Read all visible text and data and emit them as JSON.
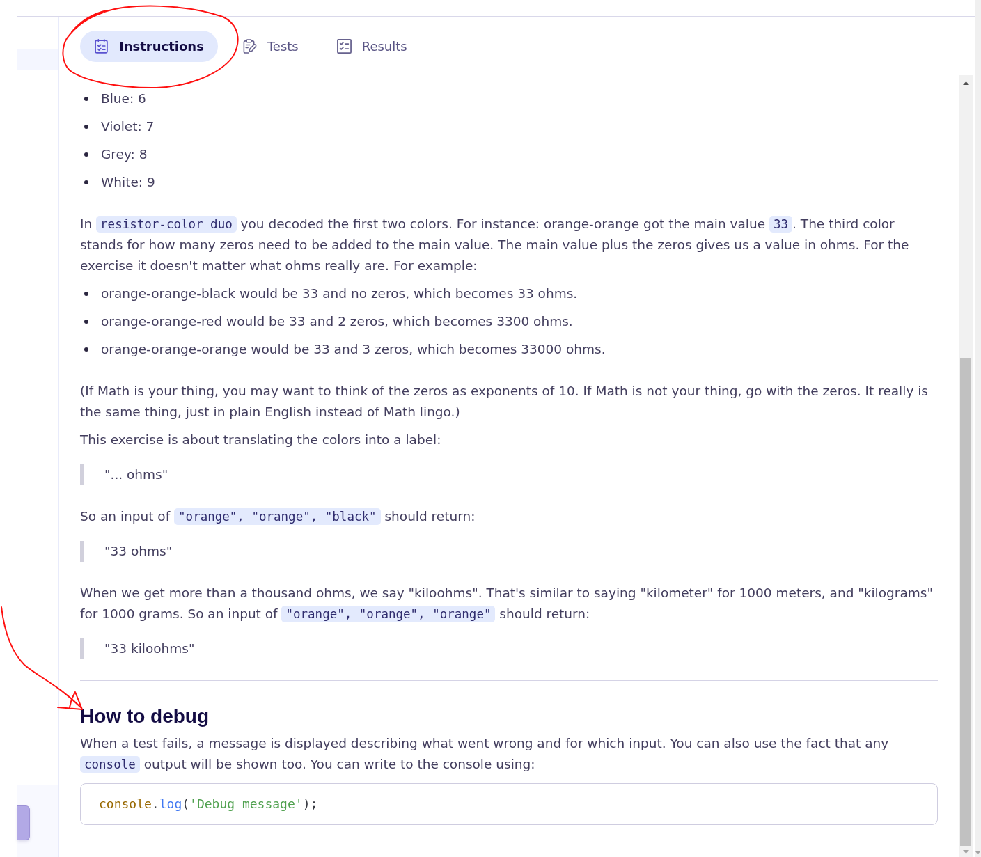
{
  "tabs": [
    {
      "label": "Instructions",
      "selected": true
    },
    {
      "label": "Tests",
      "selected": false
    },
    {
      "label": "Results",
      "selected": false
    }
  ],
  "content": [
    {
      "kind": "list",
      "items": [
        "Blue: 6",
        "Violet: 7",
        "Grey: 8",
        "White: 9"
      ]
    },
    {
      "kind": "paragraph",
      "parts": [
        {
          "kind": "text",
          "text": "In "
        },
        {
          "kind": "code",
          "text": "resistor-color duo"
        },
        {
          "kind": "text",
          "text": " you decoded the first two colors. For instance: orange-orange got the main value "
        },
        {
          "kind": "code",
          "text": "33"
        },
        {
          "kind": "text",
          "text": ". The third color stands for how many zeros need to be added to the main value. The main value plus the zeros gives us a value in ohms. For the exercise it doesn't matter what ohms really are. For example:"
        }
      ]
    },
    {
      "kind": "list",
      "items": [
        "orange-orange-black would be 33 and no zeros, which becomes 33 ohms.",
        "orange-orange-red would be 33 and 2 zeros, which becomes 3300 ohms.",
        "orange-orange-orange would be 33 and 3 zeros, which becomes 33000 ohms."
      ]
    },
    {
      "kind": "paragraph",
      "parts": [
        {
          "kind": "text",
          "text": "(If Math is your thing, you may want to think of the zeros as exponents of 10. If Math is not your thing, go with the zeros. It really is the same thing, just in plain English instead of Math lingo.)"
        }
      ]
    },
    {
      "kind": "paragraph",
      "parts": [
        {
          "kind": "text",
          "text": "This exercise is about translating the colors into a label:"
        }
      ]
    },
    {
      "kind": "quote",
      "text": "\"... ohms\""
    },
    {
      "kind": "paragraph",
      "parts": [
        {
          "kind": "text",
          "text": "So an input of "
        },
        {
          "kind": "code",
          "text": "\"orange\", \"orange\", \"black\""
        },
        {
          "kind": "text",
          "text": " should return:"
        }
      ]
    },
    {
      "kind": "quote",
      "text": "\"33 ohms\""
    },
    {
      "kind": "paragraph",
      "parts": [
        {
          "kind": "text",
          "text": "When we get more than a thousand ohms, we say \"kiloohms\". That's similar to saying \"kilometer\" for 1000 meters, and \"kilograms\" for 1000 grams. So an input of "
        },
        {
          "kind": "code",
          "text": "\"orange\", \"orange\", \"orange\""
        },
        {
          "kind": "text",
          "text": " should return:"
        }
      ]
    },
    {
      "kind": "quote",
      "text": "\"33 kiloohms\""
    },
    {
      "kind": "divider"
    },
    {
      "kind": "heading",
      "text": "How to debug"
    },
    {
      "kind": "paragraph",
      "parts": [
        {
          "kind": "text",
          "text": "When a test fails, a message is displayed describing what went wrong and for which input. You can also use the fact that any "
        },
        {
          "kind": "code",
          "text": "console"
        },
        {
          "kind": "text",
          "text": " output will be shown too. You can write to the console using:"
        }
      ]
    },
    {
      "kind": "code_block",
      "text": "console.log('Debug message');"
    }
  ],
  "annotations": [
    {
      "kind": "circle"
    },
    {
      "kind": "arrow"
    }
  ]
}
